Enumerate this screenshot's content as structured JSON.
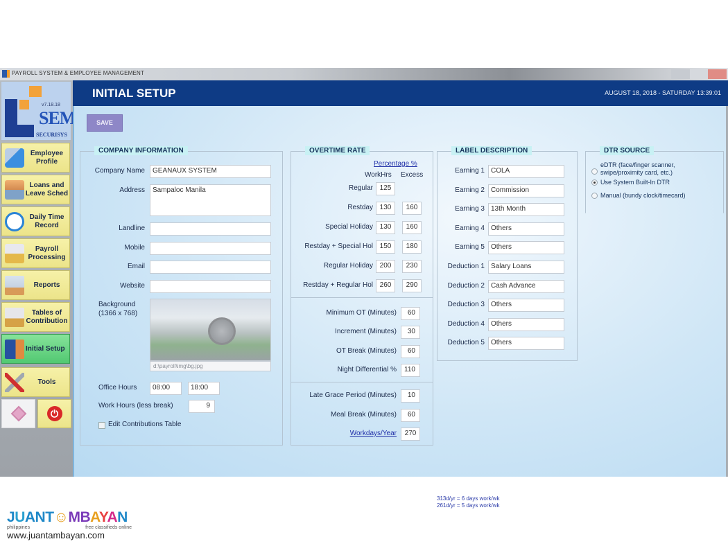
{
  "window": {
    "title": "PAYROLL SYSTEM & EMPLOYEE MANAGEMENT"
  },
  "logo": {
    "version": "v7.18.18",
    "name": "SEM",
    "brand": "SECURISYS"
  },
  "sidebar": {
    "items": [
      {
        "label": "Employee Profile",
        "icon": "employee-profile-icon"
      },
      {
        "label": "Loans and Leave Sched",
        "icon": "loans-icon"
      },
      {
        "label": "Daily Time Record",
        "icon": "clock-icon"
      },
      {
        "label": "Payroll Processing",
        "icon": "payroll-icon"
      },
      {
        "label": "Reports",
        "icon": "reports-icon"
      },
      {
        "label": "Tables of Contribution",
        "icon": "tables-icon"
      },
      {
        "label": "Initial Setup",
        "icon": "building-icon",
        "active": true
      },
      {
        "label": "Tools",
        "icon": "tools-icon"
      }
    ],
    "bottom_buttons": [
      {
        "icon": "diamond-icon"
      },
      {
        "icon": "power-icon",
        "symbol": "⏻"
      }
    ]
  },
  "header": {
    "title": "INITIAL SETUP",
    "datetime": "AUGUST 18, 2018 - SATURDAY 13:39:01"
  },
  "toolbar": {
    "save_label": "SAVE"
  },
  "company_info": {
    "title": "COMPANY INFORMATION",
    "company_name_label": "Company Name",
    "company_name": "GEANAUX SYSTEM",
    "address_label": "Address",
    "address": "Sampaloc Manila",
    "landline_label": "Landline",
    "landline": "",
    "mobile_label": "Mobile",
    "mobile": "",
    "email_label": "Email",
    "email": "",
    "website_label": "Website",
    "website": "",
    "background_label": "Background",
    "background_size": "(1366 x 768)",
    "background_path": "d:\\payroll\\img\\bg.jpg",
    "office_hours_label": "Office Hours",
    "office_hours_start": "08:00",
    "office_hours_end": "18:00",
    "work_hours_label": "Work Hours (less break)",
    "work_hours": "9",
    "edit_contrib_label": "Edit Contributions Table",
    "edit_contrib_checked": false
  },
  "overtime": {
    "title": "OVERTIME RATE",
    "percentage_link": "Percentage %",
    "col_workhrs": "WorkHrs",
    "col_excess": "Excess",
    "rows": [
      {
        "label": "Regular",
        "workhrs": "125",
        "excess": null
      },
      {
        "label": "Restday",
        "workhrs": "130",
        "excess": "160"
      },
      {
        "label": "Special Holiday",
        "workhrs": "130",
        "excess": "160"
      },
      {
        "label": "Restday + Special Hol",
        "workhrs": "150",
        "excess": "180"
      },
      {
        "label": "Regular Holiday",
        "workhrs": "200",
        "excess": "230"
      },
      {
        "label": "Restday + Regular Hol",
        "workhrs": "260",
        "excess": "290"
      }
    ],
    "settings": [
      {
        "label": "Minimum OT (Minutes)",
        "value": "60"
      },
      {
        "label": "Increment (Minutes)",
        "value": "30"
      },
      {
        "label": "OT Break (Minutes)",
        "value": "60"
      },
      {
        "label": "Night Differential %",
        "value": "110"
      }
    ],
    "other": [
      {
        "label": "Late Grace Period (Minutes)",
        "value": "10"
      },
      {
        "label": "Meal Break (Minutes)",
        "value": "60"
      }
    ],
    "workdays_link": "Workdays/Year",
    "workdays_value": "270",
    "notes": [
      "313d/yr = 6 days work/wk",
      "261d/yr = 5 days work/wk"
    ]
  },
  "label_desc": {
    "title": "LABEL DESCRIPTION",
    "rows": [
      {
        "label": "Earning 1",
        "value": "COLA"
      },
      {
        "label": "Earning 2",
        "value": "Commission"
      },
      {
        "label": "Earning 3",
        "value": "13th Month"
      },
      {
        "label": "Earning 4",
        "value": "Others"
      },
      {
        "label": "Earning 5",
        "value": "Others"
      },
      {
        "label": "Deduction 1",
        "value": "Salary Loans"
      },
      {
        "label": "Deduction 2",
        "value": "Cash Advance"
      },
      {
        "label": "Deduction 3",
        "value": "Others"
      },
      {
        "label": "Deduction 4",
        "value": "Others"
      },
      {
        "label": "Deduction 5",
        "value": "Others"
      }
    ]
  },
  "dtr_source": {
    "title": "DTR SOURCE",
    "options": [
      {
        "label_line1": "eDTR (face/finger scanner,",
        "label_line2": "swipe/proximity card, etc.)",
        "selected": false
      },
      {
        "label_line1": "Use System Built-In DTR",
        "selected": true
      },
      {
        "label_line1": "Manual (bundy clock/timecard)",
        "selected": false
      }
    ]
  },
  "watermark": {
    "brand_letters": [
      "J",
      "U",
      "A",
      "N",
      "T",
      "☺",
      "M",
      "B",
      "A",
      "Y",
      "A",
      "N"
    ],
    "tag_left": "philippines",
    "tag_right": "free classifieds online",
    "url": "www.juantambayan.com"
  },
  "colors": {
    "header_bg": "#0e3b85",
    "nav_bg": "#f6f1a8",
    "nav_active": "#52c872",
    "save_btn": "#8e87c7",
    "group_title_bg": "#c8f1f4",
    "link": "#2030a8"
  }
}
